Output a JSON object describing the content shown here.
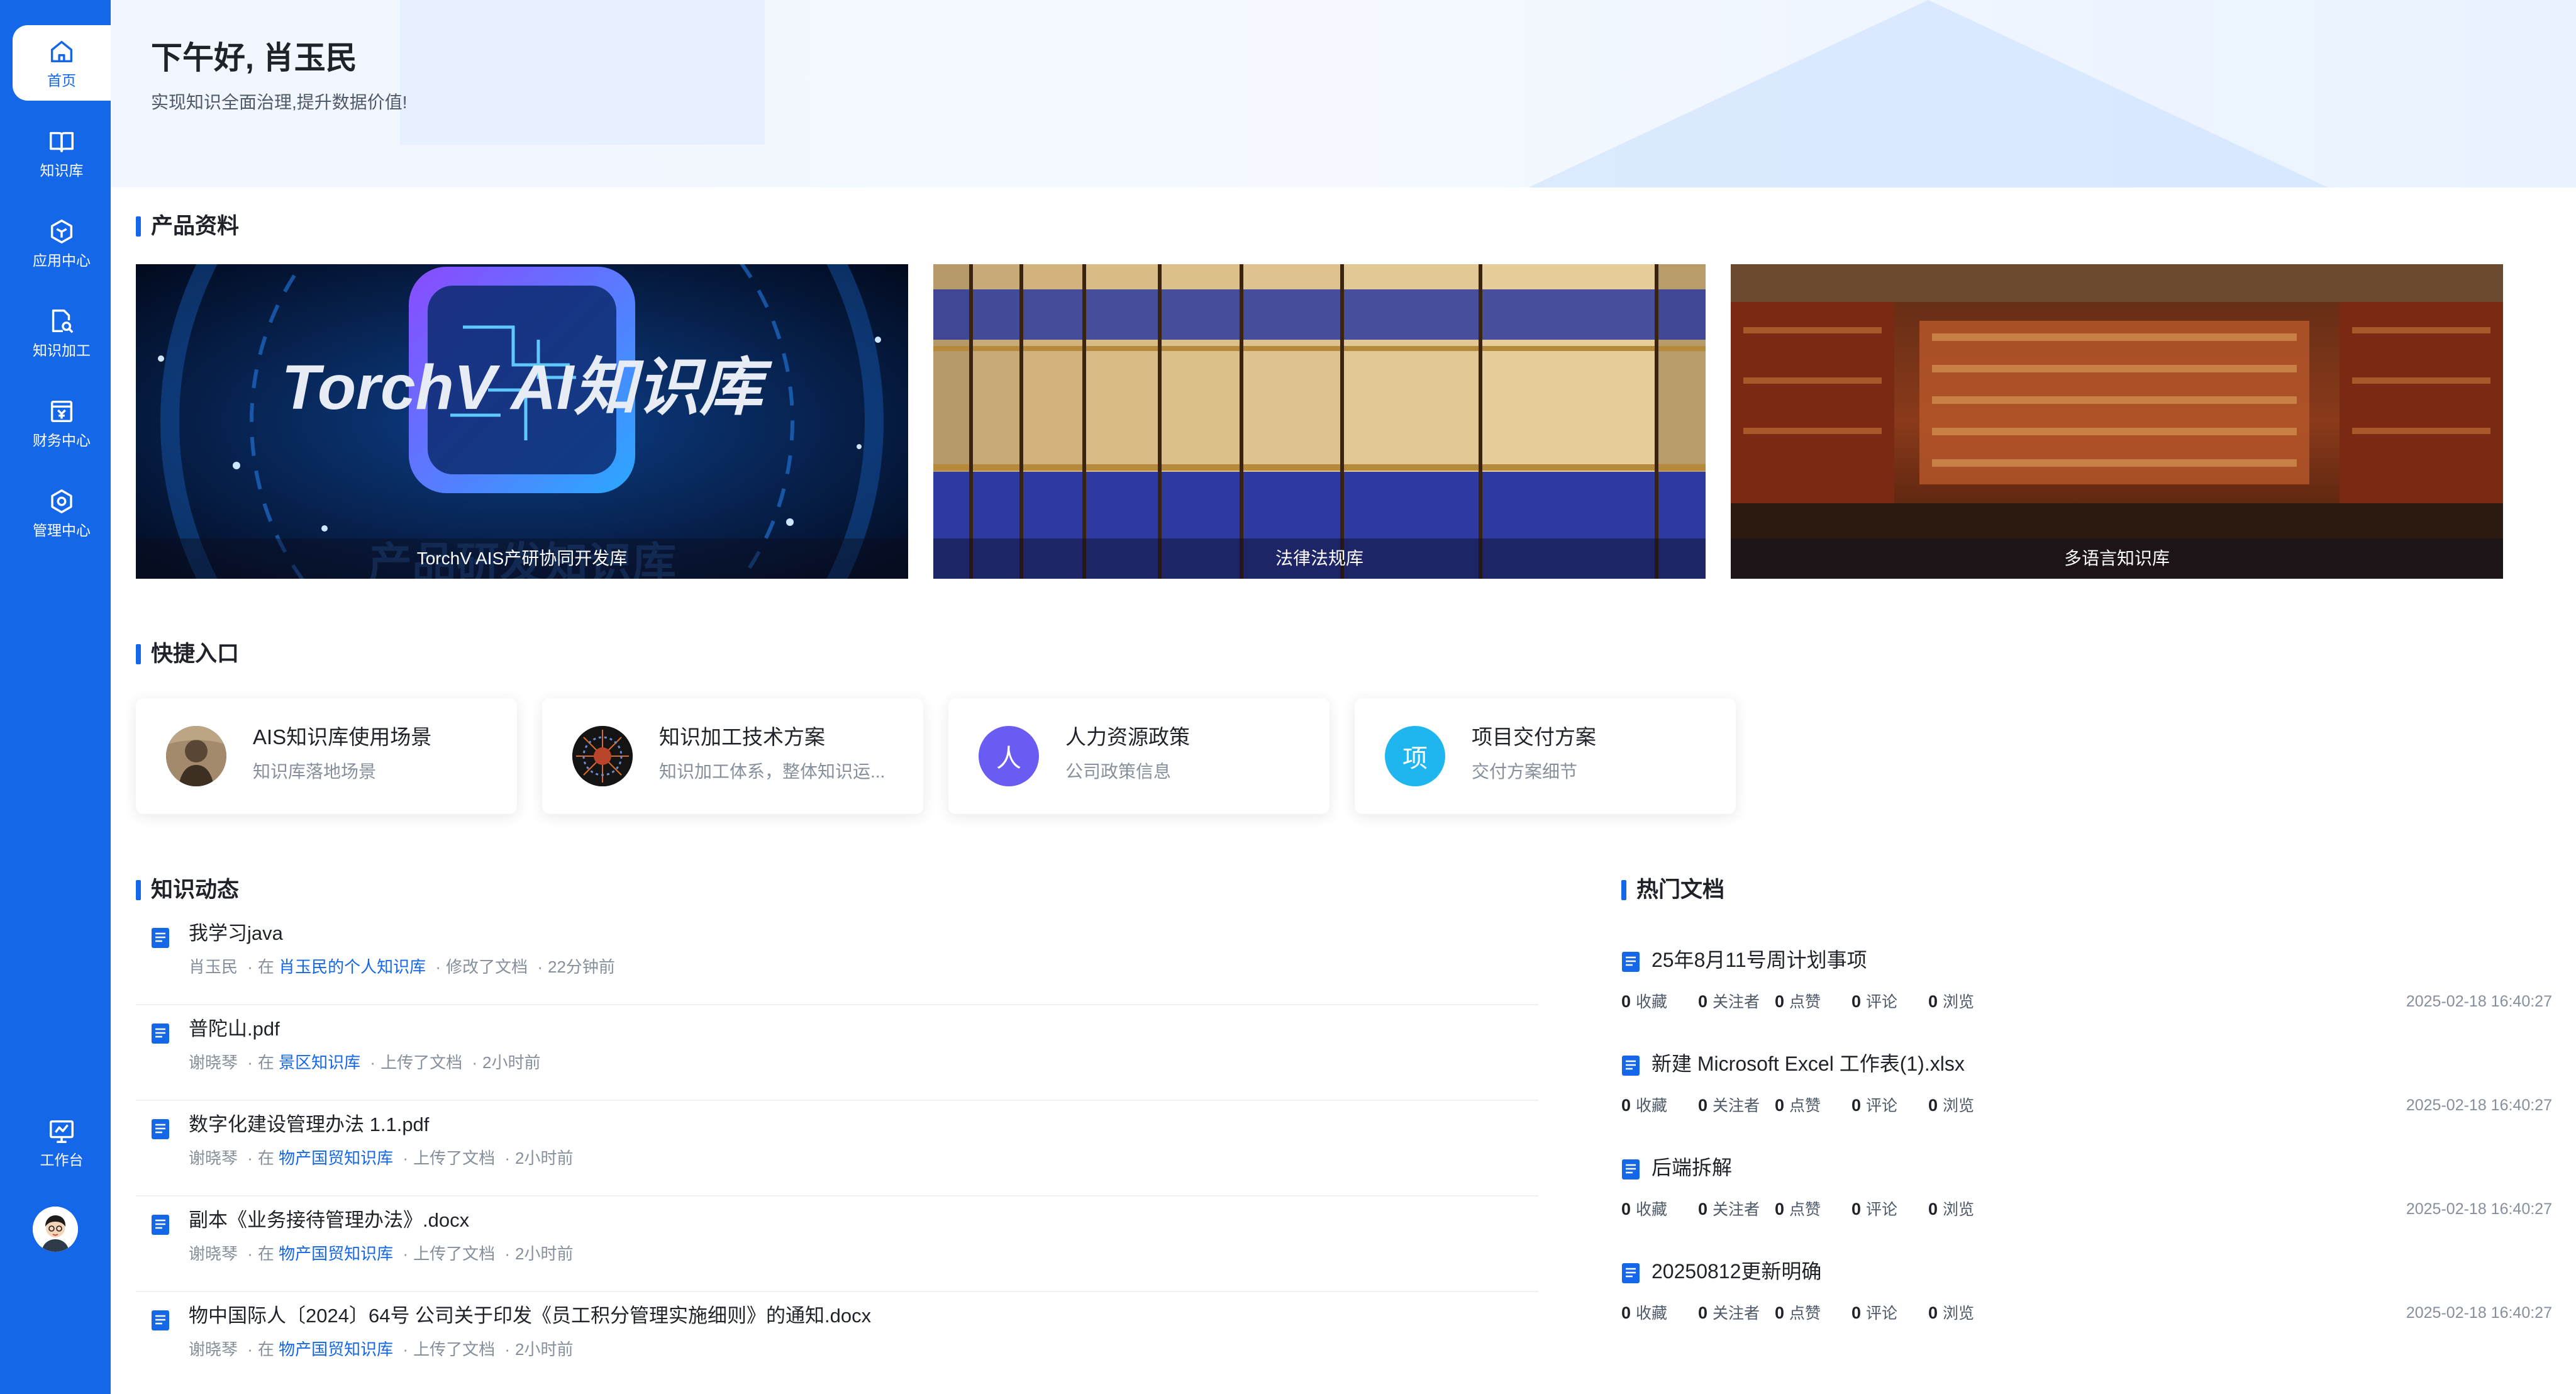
{
  "sidebar": {
    "items": [
      {
        "label": "首页",
        "icon": "home-icon",
        "active": true
      },
      {
        "label": "知识库",
        "icon": "book-icon"
      },
      {
        "label": "应用中心",
        "icon": "hexagon-icon"
      },
      {
        "label": "知识加工",
        "icon": "document-search-icon"
      },
      {
        "label": "财务中心",
        "icon": "finance-icon"
      },
      {
        "label": "管理中心",
        "icon": "settings-icon"
      }
    ],
    "workbench_label": "工作台"
  },
  "hero": {
    "greeting": "下午好, 肖玉民",
    "subtitle": "实现知识全面治理,提升数据价值!"
  },
  "products": {
    "title": "产品资料",
    "cards": [
      {
        "caption": "TorchV AIS产研协同开发库",
        "banner_text": "TorchV AI知识库",
        "banner_subtext": "产品研发知识库"
      },
      {
        "caption": "法律法规库"
      },
      {
        "caption": "多语言知识库"
      }
    ]
  },
  "quick": {
    "title": "快捷入口",
    "items": [
      {
        "title": "AIS知识库使用场景",
        "desc": "知识库落地场景",
        "icon_char": ""
      },
      {
        "title": "知识加工技术方案",
        "desc": "知识加工体系，整体知识运...",
        "icon_char": ""
      },
      {
        "title": "人力资源政策",
        "desc": "公司政策信息",
        "icon_char": "人",
        "color": "#6a5cf2"
      },
      {
        "title": "项目交付方案",
        "desc": "交付方案细节",
        "icon_char": "项",
        "color": "#1fb6f0"
      }
    ]
  },
  "feed": {
    "title": "知识动态",
    "in_word": "在",
    "items": [
      {
        "title": "我学习java",
        "user": "肖玉民",
        "kb": "肖玉民的个人知识库",
        "action": "修改了文档",
        "time": "22分钟前"
      },
      {
        "title": "普陀山.pdf",
        "user": "谢晓琴",
        "kb": "景区知识库",
        "action": "上传了文档",
        "time": "2小时前"
      },
      {
        "title": "数字化建设管理办法 1.1.pdf",
        "user": "谢晓琴",
        "kb": "物产国贸知识库",
        "action": "上传了文档",
        "time": "2小时前"
      },
      {
        "title": "副本《业务接待管理办法》.docx",
        "user": "谢晓琴",
        "kb": "物产国贸知识库",
        "action": "上传了文档",
        "time": "2小时前"
      },
      {
        "title": "物中国际人〔2024〕64号 公司关于印发《员工积分管理实施细则》的通知.docx",
        "user": "谢晓琴",
        "kb": "物产国贸知识库",
        "action": "上传了文档",
        "time": "2小时前"
      }
    ]
  },
  "hot": {
    "title": "热门文档",
    "stat_labels": {
      "fav": "收藏",
      "follow": "关注者",
      "like": "点赞",
      "comment": "评论",
      "view": "浏览"
    },
    "items": [
      {
        "title": "25年8月11号周计划事项",
        "fav": "0",
        "follow": "0",
        "like": "0",
        "comment": "0",
        "view": "0",
        "date": "2025-02-18 16:40:27"
      },
      {
        "title": "新建 Microsoft Excel 工作表(1).xlsx",
        "fav": "0",
        "follow": "0",
        "like": "0",
        "comment": "0",
        "view": "0",
        "date": "2025-02-18 16:40:27"
      },
      {
        "title": "后端拆解",
        "fav": "0",
        "follow": "0",
        "like": "0",
        "comment": "0",
        "view": "0",
        "date": "2025-02-18 16:40:27"
      },
      {
        "title": "20250812更新明确",
        "fav": "0",
        "follow": "0",
        "like": "0",
        "comment": "0",
        "view": "0",
        "date": "2025-02-18 16:40:27"
      }
    ]
  },
  "colors": {
    "accent": "#1467e8",
    "link": "#1467e8",
    "muted": "#86909c"
  }
}
